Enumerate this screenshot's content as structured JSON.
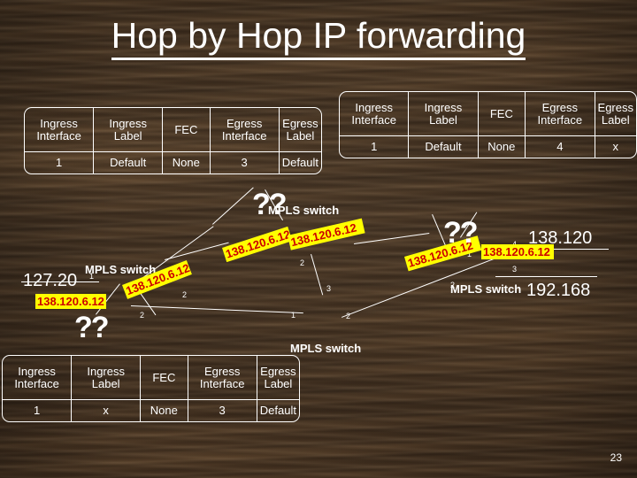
{
  "slide": {
    "title": "Hop by Hop IP forwarding",
    "page_number": "23"
  },
  "tables": {
    "headers": [
      "Ingress Interface",
      "Ingress Label",
      "FEC",
      "Egress Interface",
      "Egress Label"
    ],
    "header_parts": {
      "ingress_interface": [
        "Ingress",
        "Interface"
      ],
      "ingress_label": [
        "Ingress",
        "Label"
      ],
      "fec": [
        "FEC",
        ""
      ],
      "egress_interface": [
        "Egress",
        "Interface"
      ],
      "egress_label": [
        "Egress",
        "Label"
      ]
    },
    "top_left": {
      "ingress_interface": "1",
      "ingress_label": "Default",
      "fec": "None",
      "egress_interface": "3",
      "egress_label": "Default"
    },
    "top_right": {
      "ingress_interface": "1",
      "ingress_label": "Default",
      "fec": "None",
      "egress_interface": "4",
      "egress_label": "x"
    },
    "bottom_left": {
      "ingress_interface": "1",
      "ingress_label": "x",
      "fec": "None",
      "egress_interface": "3",
      "egress_label": "Default"
    }
  },
  "diagram": {
    "networks": [
      {
        "name": "net-127-20",
        "label": "127.20"
      },
      {
        "name": "net-138-120",
        "label": "138.120"
      },
      {
        "name": "net-192-168",
        "label": "192.168"
      }
    ],
    "switches": [
      {
        "name": "mpls-switch-left",
        "label": "MPLS switch"
      },
      {
        "name": "mpls-switch-center-top",
        "label": "MPLS switch"
      },
      {
        "name": "mpls-switch-center-bottom",
        "label": "MPLS switch"
      },
      {
        "name": "mpls-switch-right",
        "label": "MPLS switch"
      }
    ],
    "interface_numbers": [
      "1",
      "2",
      "2",
      "1",
      "2",
      "3",
      "2",
      "2",
      "1",
      "2",
      "4",
      "3"
    ],
    "packets": [
      {
        "name": "packet-left-horizontal",
        "label": "138.120.6.12"
      },
      {
        "name": "packet-left-rotated",
        "label": "138.120.6.12"
      },
      {
        "name": "packet-center-left-rotated",
        "label": "138.120.6.12"
      },
      {
        "name": "packet-center-right-rotated",
        "label": "138.120.6.12"
      },
      {
        "name": "packet-right-rotated",
        "label": "138.120.6.12"
      },
      {
        "name": "packet-right-horizontal",
        "label": "138.120.6.12"
      }
    ],
    "question_marks": [
      {
        "name": "question-left",
        "label": "??"
      },
      {
        "name": "question-center",
        "label": "??"
      },
      {
        "name": "question-right",
        "label": "??"
      }
    ]
  }
}
